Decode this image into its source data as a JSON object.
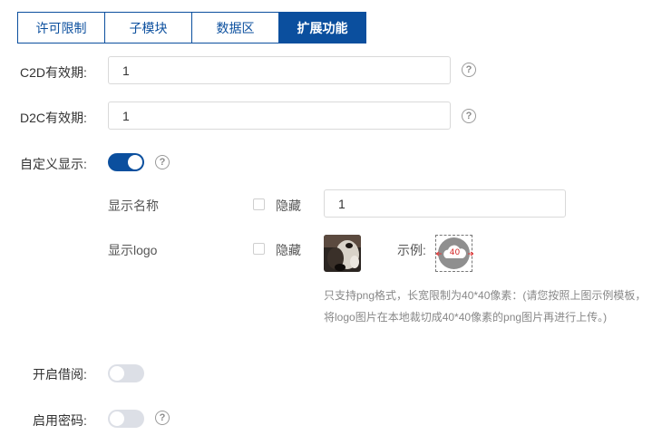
{
  "tabs": [
    {
      "label": "许可限制",
      "active": false
    },
    {
      "label": "子模块",
      "active": false
    },
    {
      "label": "数据区",
      "active": false
    },
    {
      "label": "扩展功能",
      "active": true
    }
  ],
  "form": {
    "c2d": {
      "label": "C2D有效期:",
      "value": "1"
    },
    "d2c": {
      "label": "D2C有效期:",
      "value": "1"
    },
    "custom_display": {
      "label": "自定义显示:",
      "enabled": true
    },
    "display_name": {
      "label": "显示名称",
      "hide_label": "隐藏",
      "hidden": false,
      "value": "1"
    },
    "display_logo": {
      "label": "显示logo",
      "hide_label": "隐藏",
      "hidden": false,
      "example_label": "示例:",
      "example_size": "40"
    },
    "hint_line1": "只支持png格式，长宽限制为40*40像素：(请您按照上图示例模板，",
    "hint_line2": "将logo图片在本地裁切成40*40像素的png图片再进行上传。)",
    "enable_borrow": {
      "label": "开启借阅:",
      "enabled": false
    },
    "enable_password": {
      "label": "启用密码:",
      "enabled": false
    }
  },
  "help_glyph": "?",
  "colors": {
    "accent": "#0b4f9e",
    "switch_off": "#dcdfe6",
    "border": "#d9d9d9"
  }
}
